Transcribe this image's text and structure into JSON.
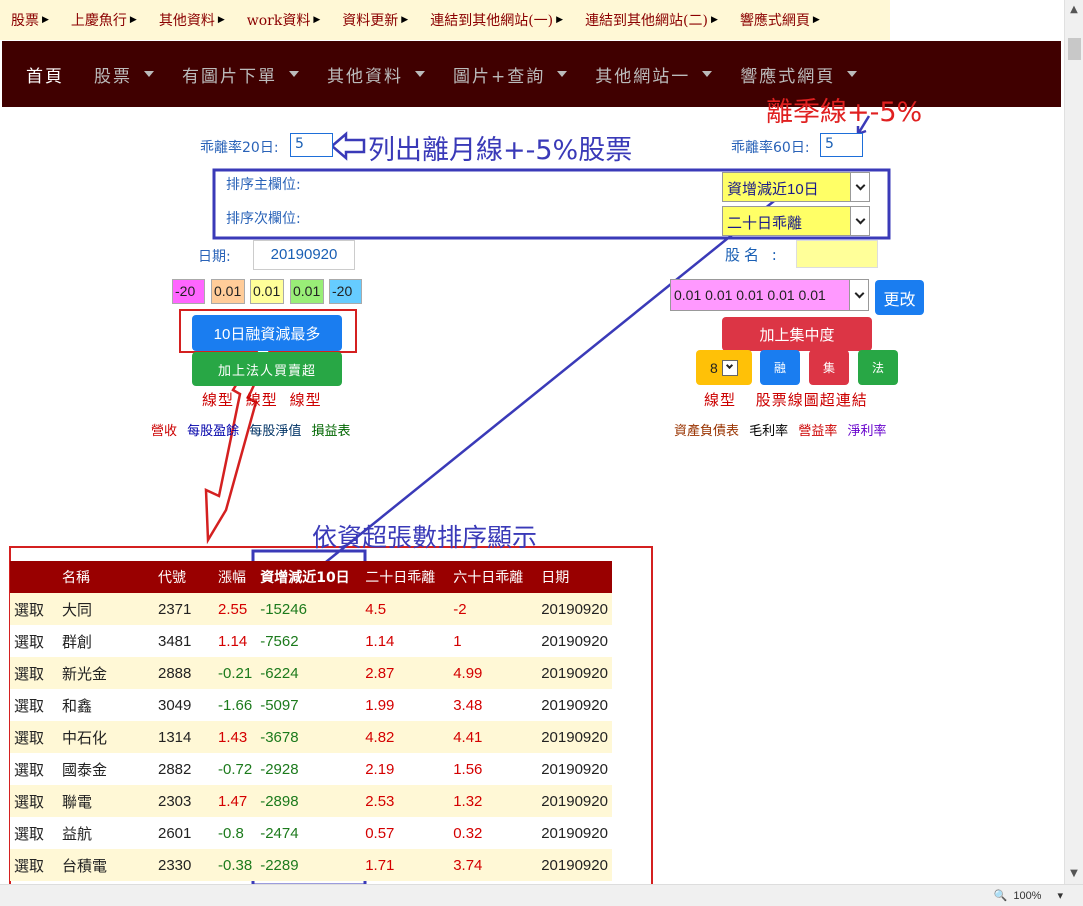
{
  "top_menu": [
    {
      "label": "股票"
    },
    {
      "label": "上慶魚行"
    },
    {
      "label": "其他資料"
    },
    {
      "label": "work資料"
    },
    {
      "label": "資料更新"
    },
    {
      "label": "連結到其他網站(一)"
    },
    {
      "label": "連結到其他網站(二)"
    },
    {
      "label": "響應式網頁"
    }
  ],
  "navbar": {
    "home": "首頁",
    "items": [
      {
        "label": "股票"
      },
      {
        "label": "有圖片下單"
      },
      {
        "label": "其他資料"
      },
      {
        "label": "圖片+查詢"
      },
      {
        "label": "其他網站一"
      },
      {
        "label": "響應式網頁"
      }
    ]
  },
  "filters": {
    "ratio20_label": "乖離率20日:",
    "ratio20_value": "5",
    "ratio60_label": "乖離率60日:",
    "ratio60_value": "5",
    "sort_primary_label": "排序主欄位:",
    "sort_primary_value": "資增減近10日",
    "sort_secondary_label": "排序次欄位:",
    "sort_secondary_value": "二十日乖離",
    "date_label": "日期:",
    "date_value": "20190920",
    "stock_name_label": "股名 :",
    "stock_name_value": ""
  },
  "param_boxes": [
    {
      "value": "-20",
      "color": "#ff66ff"
    },
    {
      "value": "0.01",
      "color": "#ffcc99"
    },
    {
      "value": "0.01",
      "color": "#ffff99"
    },
    {
      "value": "0.01",
      "color": "#99ee77"
    },
    {
      "value": "-20",
      "color": "#66ccff"
    }
  ],
  "params_select": "0.01 0.01 0.01 0.01 0.01",
  "buttons": {
    "update": "更改",
    "margin_decrease": "10日融資減最多",
    "add_concentration": "加上集中度",
    "legal_buy": "加上法人買賣超",
    "count_select": "8",
    "rong": "融",
    "ji": "集",
    "fa": "法"
  },
  "links_left_1": [
    "線型",
    "線型",
    "線型"
  ],
  "links_left_2": [
    {
      "label": "營收",
      "color": "#cc0000"
    },
    {
      "label": "每股盈餘",
      "color": "#0000aa"
    },
    {
      "label": "每股淨值",
      "color": "#003366"
    },
    {
      "label": "損益表",
      "color": "#006600"
    }
  ],
  "links_right_1": [
    "線型",
    "股票線圖超連結"
  ],
  "links_right_2": [
    {
      "label": "資產負債表",
      "color": "#993300"
    },
    {
      "label": "毛利率",
      "color": "#000000"
    },
    {
      "label": "營益率",
      "color": "#cc0000"
    },
    {
      "label": "淨利率",
      "color": "#6600cc"
    }
  ],
  "annotations": {
    "list_month": "列出離月線+-5%股票",
    "season": "離季線+-5%",
    "sort_display": "依資超張數排序顯示"
  },
  "table": {
    "headers": [
      "",
      "名稱",
      "代號",
      "漲幅",
      "資增減近10日",
      "二十日乖離",
      "六十日乖離",
      "日期"
    ],
    "rows": [
      {
        "action": "選取",
        "name": "大同",
        "code": "2371",
        "change": "2.55",
        "margin10": "-15246",
        "dev20": "4.5",
        "dev60": "-2",
        "date": "20190920"
      },
      {
        "action": "選取",
        "name": "群創",
        "code": "3481",
        "change": "1.14",
        "margin10": "-7562",
        "dev20": "1.14",
        "dev60": "1",
        "date": "20190920"
      },
      {
        "action": "選取",
        "name": "新光金",
        "code": "2888",
        "change": "-0.21",
        "margin10": "-6224",
        "dev20": "2.87",
        "dev60": "4.99",
        "date": "20190920"
      },
      {
        "action": "選取",
        "name": "和鑫",
        "code": "3049",
        "change": "-1.66",
        "margin10": "-5097",
        "dev20": "1.99",
        "dev60": "3.48",
        "date": "20190920"
      },
      {
        "action": "選取",
        "name": "中石化",
        "code": "1314",
        "change": "1.43",
        "margin10": "-3678",
        "dev20": "4.82",
        "dev60": "4.41",
        "date": "20190920"
      },
      {
        "action": "選取",
        "name": "國泰金",
        "code": "2882",
        "change": "-0.72",
        "margin10": "-2928",
        "dev20": "2.19",
        "dev60": "1.56",
        "date": "20190920"
      },
      {
        "action": "選取",
        "name": "聯電",
        "code": "2303",
        "change": "1.47",
        "margin10": "-2898",
        "dev20": "2.53",
        "dev60": "1.32",
        "date": "20190920"
      },
      {
        "action": "選取",
        "name": "益航",
        "code": "2601",
        "change": "-0.8",
        "margin10": "-2474",
        "dev20": "0.57",
        "dev60": "0.32",
        "date": "20190920"
      },
      {
        "action": "選取",
        "name": "台積電",
        "code": "2330",
        "change": "-0.38",
        "margin10": "-2289",
        "dev20": "1.71",
        "dev60": "3.74",
        "date": "20190920"
      }
    ]
  },
  "status": {
    "zoom": "100%"
  }
}
